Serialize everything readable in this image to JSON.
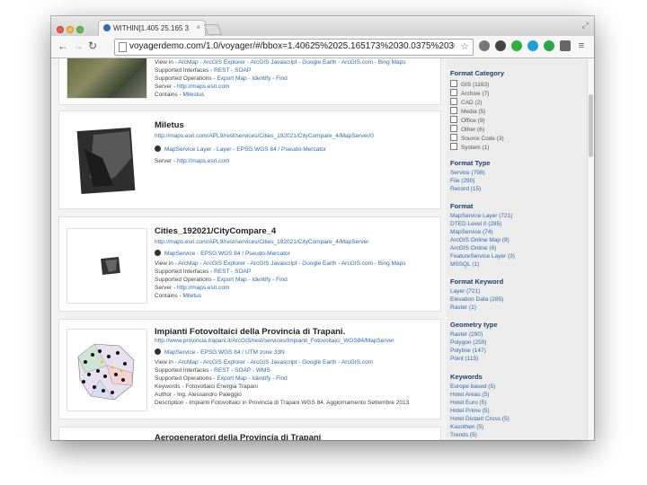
{
  "browser": {
    "tab_title": "WITHIN[1.405 25.165 30",
    "tab_close": "×",
    "url": "voyagerdemo.com/1.0/voyager/#/bbox=1.40625%2025.165173%2030.0375%2030.3",
    "buttons": {
      "back": "←",
      "forward": "→",
      "reload": "↻",
      "star": "☆"
    }
  },
  "results": [
    {
      "title": "",
      "lines": [
        {
          "label": "View in",
          "links": "ArcMap - ArcGIS Explorer - ArcGIS Javascript - Google Earth - ArcGIS.com - Bing Maps"
        },
        {
          "label": "Supported Interfaces",
          "links": "REST - SOAP"
        },
        {
          "label": "Supported Operations",
          "links": "Export Map - Identify - Find"
        },
        {
          "label": "Server",
          "links": "http://maps.esri.com"
        },
        {
          "label": "Contains",
          "links": "Milestus"
        }
      ]
    },
    {
      "title": "Miletus",
      "url": "http://maps.esri.com/APL9/rest/services/Cities_192021/CityCompare_4/MapServer/0",
      "format": "MapService Layer - Layer - EPSG:WGS 84 / Pseudo-Mercator",
      "lines": [
        {
          "label": "Server",
          "links": "http://maps.esri.com"
        }
      ]
    },
    {
      "title": "Cities_192021/CityCompare_4",
      "url": "http://maps.esri.com/APL9/rest/services/Cities_192021/CityCompare_4/MapServer",
      "format": "MapService - EPSG:WGS 84 / Pseudo-Mercator",
      "lines": [
        {
          "label": "View in",
          "links": "ArcMap - ArcGIS Explorer - ArcGIS Javascript - Google Earth - ArcGIS.com - Bing Maps"
        },
        {
          "label": "Supported Interfaces",
          "links": "REST - SOAP"
        },
        {
          "label": "Supported Operations",
          "links": "Export Map - Identify - Find"
        },
        {
          "label": "Server",
          "links": "http://maps.esri.com"
        },
        {
          "label": "Contains",
          "links": "Miletus"
        }
      ]
    },
    {
      "title": "Impianti Fotovoltaici della Provincia di Trapani.",
      "url": "http://www.provincia.trapani.it/ArcGIS/rest/services/Impianti_Fotovoltaici_WGS84/MapServer",
      "format": "MapService - EPSG:WGS 84 / UTM zone 33N",
      "lines": [
        {
          "label": "View in",
          "links": "ArcMap - ArcGIS Explorer - ArcGIS Javascript - Google Earth - ArcGIS.com"
        },
        {
          "label": "Supported Interfaces",
          "links": "REST - SOAP - WMS"
        },
        {
          "label": "Supported Operations",
          "links": "Export Map - Identify - Find"
        },
        {
          "label": "Keywords",
          "links": "Fotovoltaici Energia Trapani"
        },
        {
          "label": "Author",
          "links": "Ing. Alessandro Paleggio"
        },
        {
          "label": "Description",
          "links": "Impianti Fotovoltaici in Provincia di Trapani WGS 84. Aggiornamento Settembre 2013"
        }
      ]
    },
    {
      "title": "Aerogeneratori della Provincia di Trapani"
    }
  ],
  "sidebar": {
    "format_category": {
      "heading": "Format Category",
      "items": [
        "GIS (1183)",
        "Archive (7)",
        "CAD (2)",
        "Media (5)",
        "Office (9)",
        "Other (6)",
        "Source Code (3)",
        "System (1)"
      ]
    },
    "format_type": {
      "heading": "Format Type",
      "items": [
        "Service (798)",
        "File (290)",
        "Record (15)"
      ]
    },
    "format": {
      "heading": "Format",
      "items": [
        "MapService Layer (721)",
        "DTED Level 0 (285)",
        "MapService (74)",
        "ArcGIS Online Map (8)",
        "ArcGIS Online (6)",
        "FeatureService Layer (3)",
        "MSSQL (1)"
      ]
    },
    "format_keyword": {
      "heading": "Format Keyword",
      "items": [
        "Layer (721)",
        "Elevation Data (285)",
        "Raster (1)"
      ]
    },
    "geometry_type": {
      "heading": "Geometry type",
      "items": [
        "Raster (290)",
        "Polygon (250)",
        "Polyline (147)",
        "Point (115)"
      ]
    },
    "keywords": {
      "heading": "Keywords",
      "items": [
        "Europe based (5)",
        "Hotel Areas (5)",
        "Hotel Euro (5)",
        "Hotel Prime (5)",
        "Hotel Distant Cross (5)",
        "Kasothen (5)",
        "Trends (5)"
      ]
    }
  },
  "colors": {
    "link": "#2a6bb3",
    "heading": "#1f3f66",
    "title": "#222222"
  }
}
